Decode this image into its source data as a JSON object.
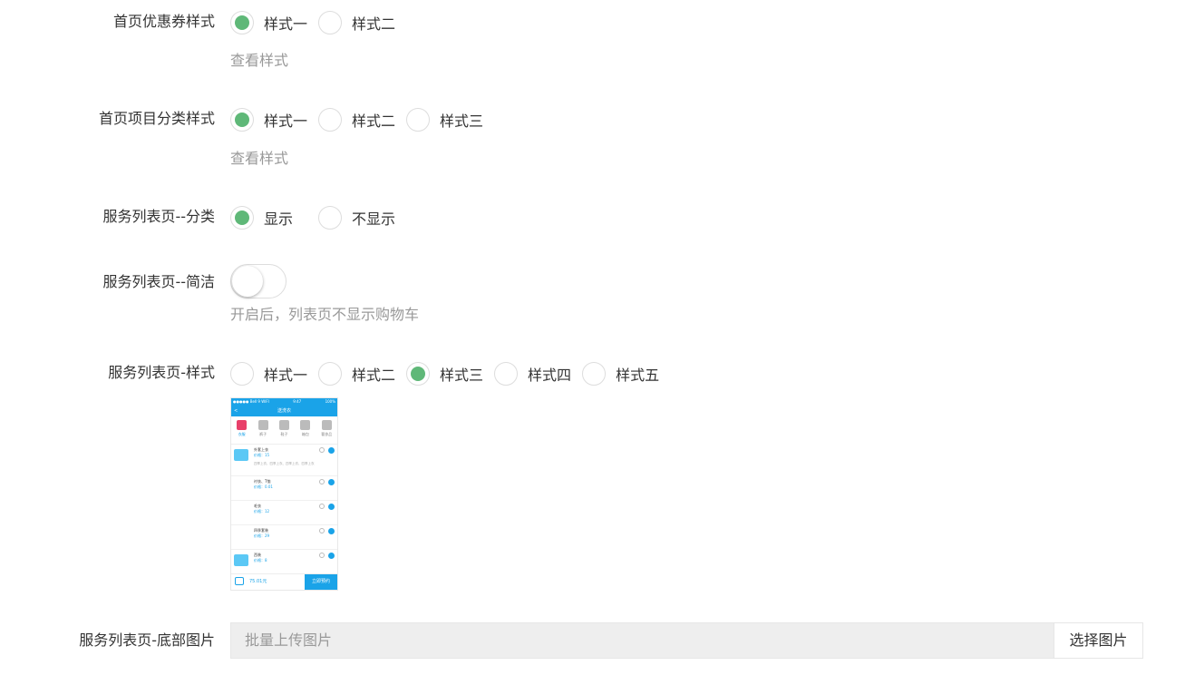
{
  "coupon_style": {
    "label": "首页优惠券样式",
    "options": [
      "样式一",
      "样式二"
    ],
    "selected": 0,
    "hint": "查看样式"
  },
  "category_style": {
    "label": "首页项目分类样式",
    "options": [
      "样式一",
      "样式二",
      "样式三"
    ],
    "selected": 0,
    "hint": "查看样式"
  },
  "service_category": {
    "label": "服务列表页--分类",
    "options": [
      "显示",
      "不显示"
    ],
    "selected": 0
  },
  "service_simple": {
    "label": "服务列表页--简洁",
    "enabled": false,
    "hint": "开启后，列表页不显示购物车"
  },
  "service_style": {
    "label": "服务列表页-样式",
    "options": [
      "样式一",
      "样式二",
      "样式三",
      "样式四",
      "样式五"
    ],
    "selected": 2
  },
  "preview": {
    "status_left": "●●●●● Bell 9 WIFI",
    "status_time": "9:47",
    "status_right": "100%",
    "nav_title": "送洗衣",
    "back": "<",
    "cats": [
      "衣服",
      "裤子",
      "鞋子",
      "箱包",
      "奢侈品"
    ],
    "items": [
      {
        "name": "外套上衣",
        "price": "价格：15",
        "sub": "四季上衣、四季上衣、四季上衣、四季上衣"
      },
      {
        "name": "衬衣、T恤",
        "price": "价格：0.01"
      },
      {
        "name": "毛衣",
        "price": "价格：12"
      },
      {
        "name": "四季套装",
        "price": "价格：29"
      },
      {
        "name": "西装",
        "price": "价格：8"
      }
    ],
    "total": "75.01元",
    "checkout": "立即预约"
  },
  "bottom_image": {
    "label": "服务列表页-底部图片",
    "placeholder": "批量上传图片",
    "button": "选择图片"
  },
  "colors": {
    "accent": "#5fb878",
    "preview_blue": "#1aa3e8"
  }
}
